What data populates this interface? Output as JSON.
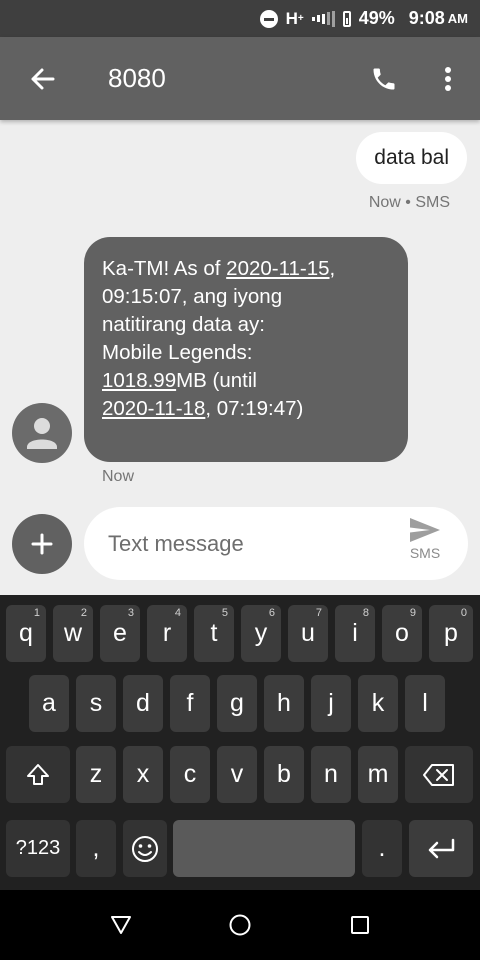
{
  "status_bar": {
    "network": "H",
    "network_sup": "+",
    "battery": "49%",
    "time": "9:08",
    "ampm": "AM"
  },
  "app_bar": {
    "title": "8080"
  },
  "messages": {
    "outgoing": {
      "text": "data bal",
      "meta": "Now • SMS"
    },
    "incoming": {
      "line1_a": "Ka-TM! As of ",
      "line1_date": "2020-11-15",
      "line1_b": ",",
      "line2": "09:15:07, ang iyong",
      "line3": "natitirang data ay:",
      "line4": "Mobile Legends:",
      "line5_value": "1018.99",
      "line5_rest": "MB (until",
      "line6_date": "2020-11-18",
      "line6_rest": ", 07:19:47)",
      "meta": "Now"
    }
  },
  "compose": {
    "placeholder": "Text message",
    "send_label": "SMS"
  },
  "keyboard": {
    "row1": [
      {
        "key": "q",
        "hint": "1"
      },
      {
        "key": "w",
        "hint": "2"
      },
      {
        "key": "e",
        "hint": "3"
      },
      {
        "key": "r",
        "hint": "4"
      },
      {
        "key": "t",
        "hint": "5"
      },
      {
        "key": "y",
        "hint": "6"
      },
      {
        "key": "u",
        "hint": "7"
      },
      {
        "key": "i",
        "hint": "8"
      },
      {
        "key": "o",
        "hint": "9"
      },
      {
        "key": "p",
        "hint": "0"
      }
    ],
    "row2": [
      "a",
      "s",
      "d",
      "f",
      "g",
      "h",
      "j",
      "k",
      "l"
    ],
    "row3": [
      "z",
      "x",
      "c",
      "v",
      "b",
      "n",
      "m"
    ],
    "symbols_label": "?123",
    "comma": ",",
    "period": "."
  },
  "colors": {
    "app_bar": "#616161",
    "status_bar": "#3f3f3f",
    "incoming_bubble": "#616161",
    "outgoing_bubble": "#ffffff",
    "keyboard_bg": "#212121"
  }
}
